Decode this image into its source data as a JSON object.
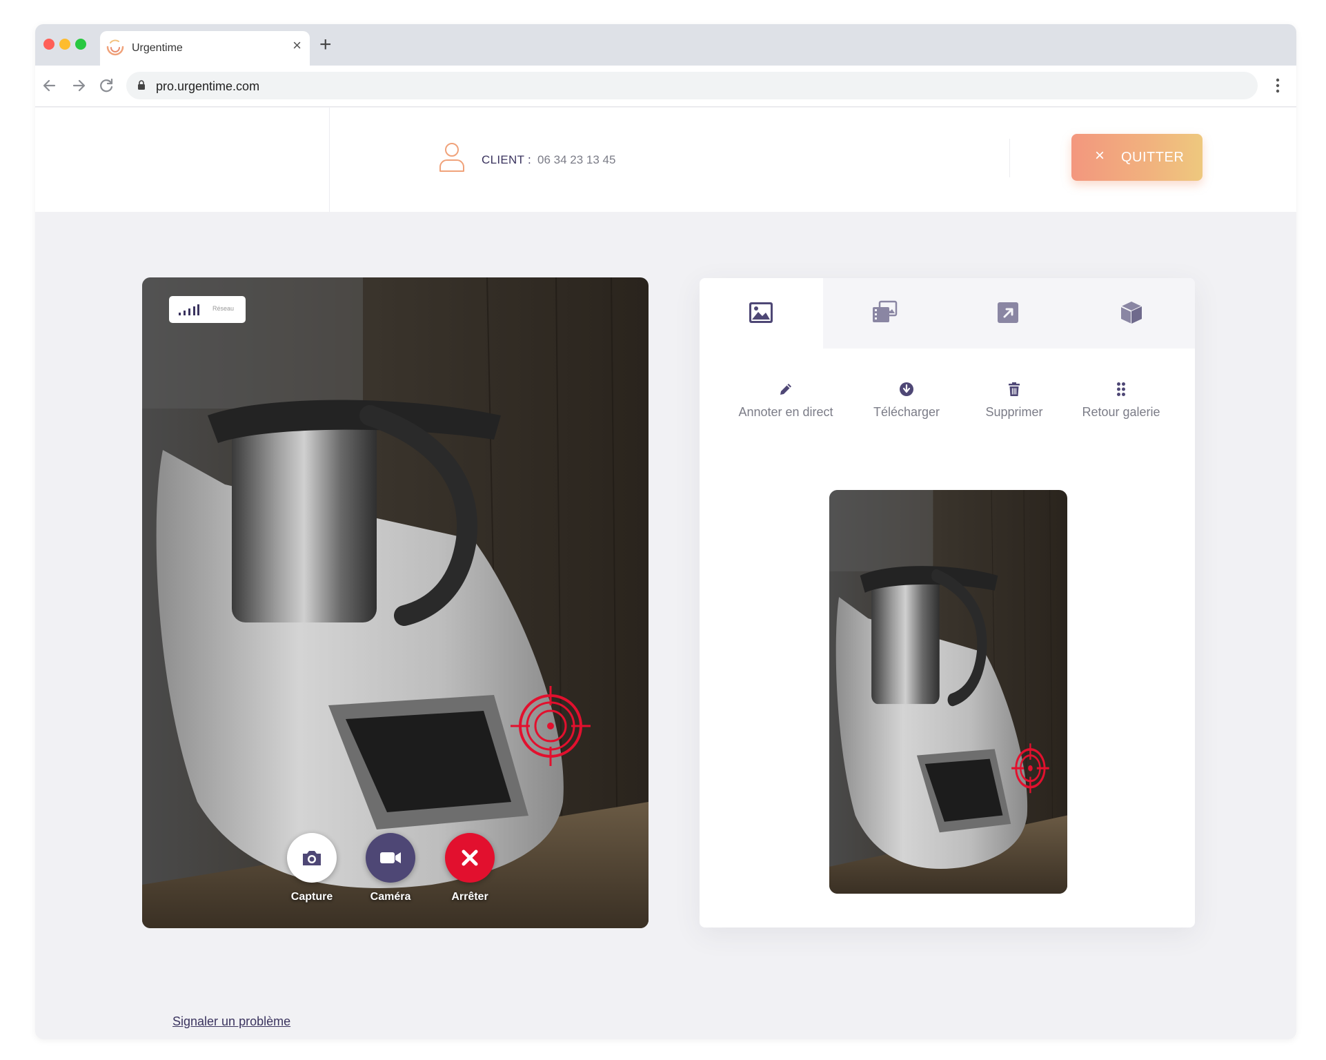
{
  "browser": {
    "tab_title": "Urgentime",
    "tab_close": "×",
    "new_tab": "+",
    "url": "pro.urgentime.com"
  },
  "header": {
    "client_label": "CLIENT :",
    "client_phone": "06 34 23 13 45",
    "quit_icon": "×",
    "quit_label": "QUITTER",
    "quit_gradient": [
      "#f3977e",
      "#eec87e"
    ]
  },
  "video": {
    "network_label": "Réseau",
    "controls": [
      {
        "label": "Capture",
        "icon": "camera-icon",
        "color": "#ffffff"
      },
      {
        "label": "Caméra",
        "icon": "video-camera-icon",
        "color": "#4e4775"
      },
      {
        "label": "Arrêter",
        "icon": "close-icon",
        "color": "#e2102e"
      }
    ]
  },
  "panel": {
    "tabs": [
      {
        "icon": "image-icon",
        "active": true
      },
      {
        "icon": "gallery-icon",
        "active": false
      },
      {
        "icon": "share-icon",
        "active": false
      },
      {
        "icon": "cube-icon",
        "active": false
      }
    ],
    "actions": [
      {
        "label": "Annoter en direct",
        "icon": "pencil-icon"
      },
      {
        "label": "Télécharger",
        "icon": "download-icon"
      },
      {
        "label": "Supprimer",
        "icon": "trash-icon"
      },
      {
        "label": "Retour galerie",
        "icon": "grid-icon"
      }
    ]
  },
  "footer": {
    "report_link": "Signaler un problème"
  },
  "colors": {
    "primary": "#4e4775",
    "danger": "#e2102e",
    "text_muted": "#7b7c87",
    "accent_orange": "#f3977e"
  }
}
